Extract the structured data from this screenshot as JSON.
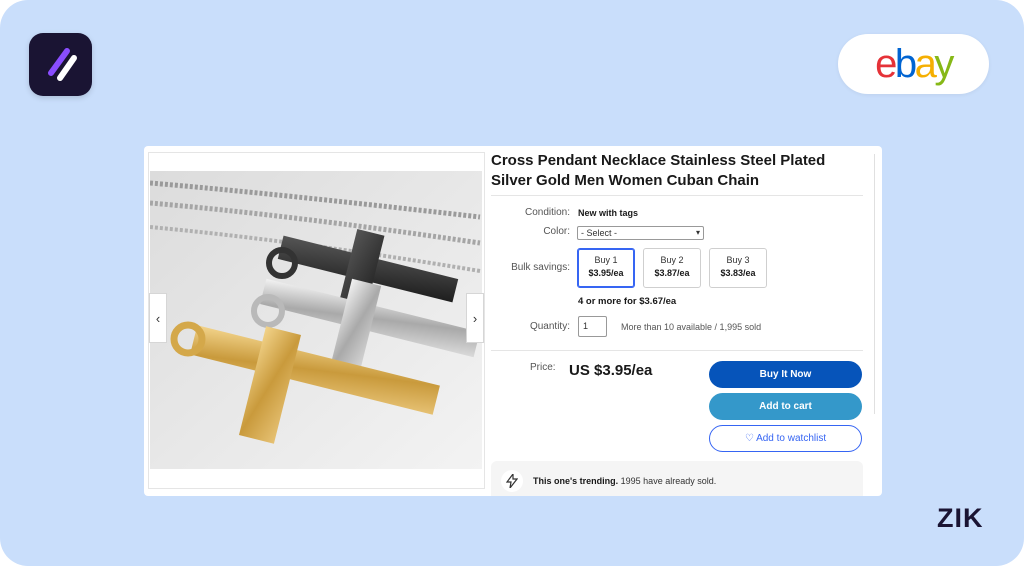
{
  "brand": {
    "app_name": "app-logo",
    "ebay": [
      "e",
      "b",
      "a",
      "y"
    ],
    "watermark": "ZIK"
  },
  "colors": {
    "background": "#c9defb",
    "ebay_blue": "#0654ba",
    "cart_blue": "#3498ca",
    "link_blue": "#3665f3"
  },
  "product": {
    "title": "Cross Pendant Necklace Stainless Steel Plated Silver Gold Men Women Cuban Chain",
    "condition_label": "Condition:",
    "condition_value": "New with tags",
    "color_label": "Color:",
    "color_select": "- Select -",
    "bulk_label": "Bulk savings:",
    "bulk_options": [
      {
        "label": "Buy 1",
        "price": "$3.95/ea"
      },
      {
        "label": "Buy 2",
        "price": "$3.87/ea"
      },
      {
        "label": "Buy 3",
        "price": "$3.83/ea"
      }
    ],
    "bulk_more": "4 or more for $3.67/ea",
    "quantity_label": "Quantity:",
    "quantity_value": "1",
    "availability": "More than 10 available / 1,995 sold",
    "price_label": "Price:",
    "price_value": "US $3.95/ea",
    "buy_now": "Buy It Now",
    "add_to_cart": "Add to cart",
    "watchlist": "♡ Add to watchlist",
    "trend_bold": "This one's trending.",
    "trend_rest": " 1995 have already sold."
  },
  "icons": {
    "prev": "chevron-left-icon",
    "next": "chevron-right-icon",
    "bolt": "lightning-icon"
  }
}
